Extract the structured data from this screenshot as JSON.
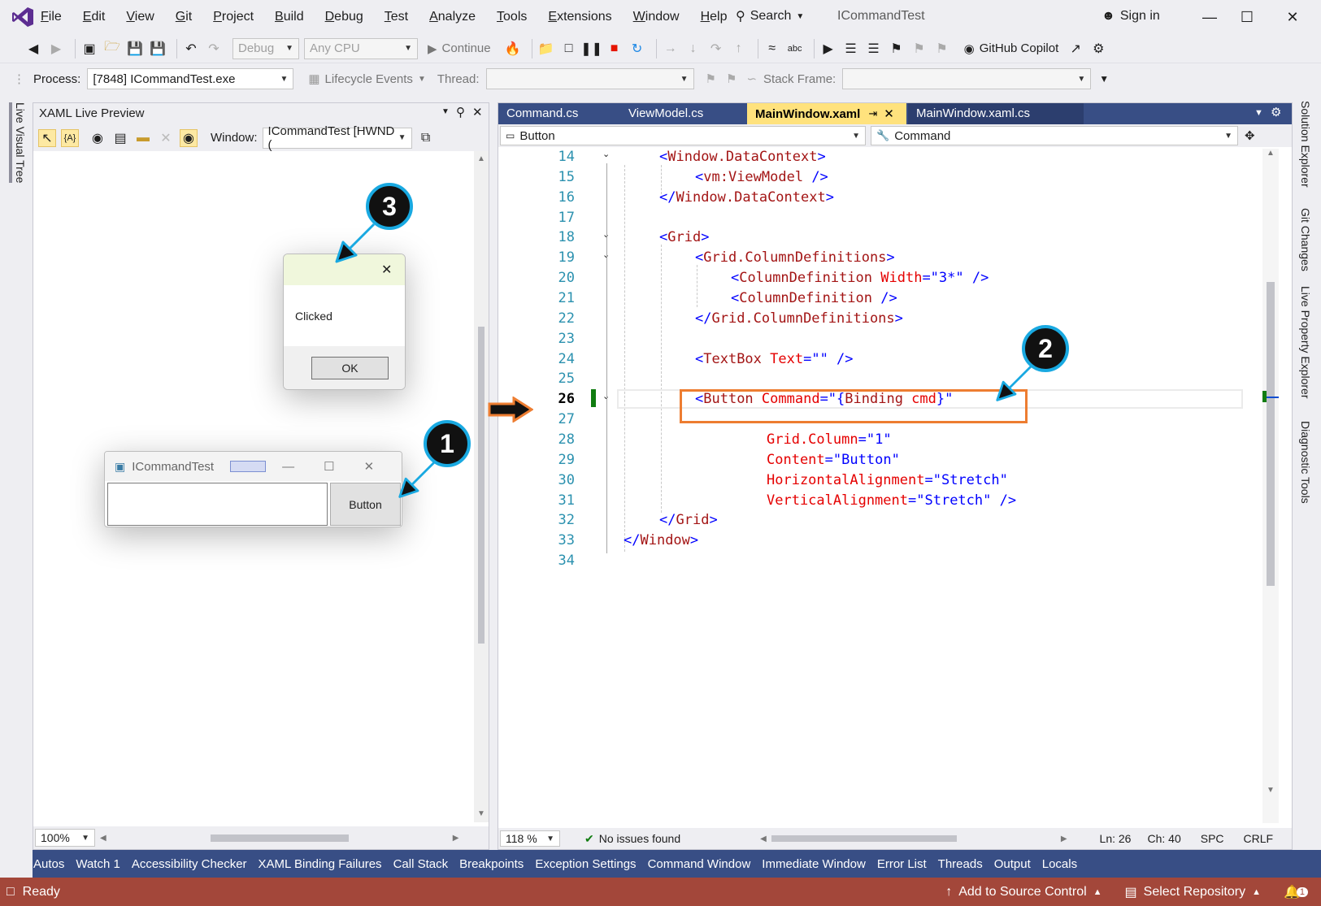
{
  "title_bar": {
    "menus": [
      "File",
      "Edit",
      "View",
      "Git",
      "Project",
      "Build",
      "Debug",
      "Test",
      "Analyze",
      "Tools",
      "Extensions",
      "Window",
      "Help"
    ],
    "search_label": "Search",
    "app_name": "ICommandTest",
    "sign_in": "Sign in"
  },
  "toolbar": {
    "config": "Debug",
    "platform": "Any CPU",
    "continue_label": "Continue",
    "copilot_label": "GitHub Copilot"
  },
  "debug_toolbar": {
    "process_label": "Process:",
    "process_value": "[7848] ICommandTest.exe",
    "lifecycle_label": "Lifecycle Events",
    "thread_label": "Thread:",
    "stack_frame_label": "Stack Frame:"
  },
  "left_strip": {
    "label": "Live Visual Tree"
  },
  "right_strip": {
    "labels": [
      "Solution Explorer",
      "Git Changes",
      "Live Property Explorer",
      "Diagnostic Tools"
    ]
  },
  "live_preview": {
    "title": "XAML Live Preview",
    "window_label": "Window:",
    "window_value": "ICommandTest [HWND (",
    "zoom": "100%"
  },
  "message_box": {
    "text": "Clicked",
    "ok_label": "OK"
  },
  "app_window": {
    "title": "ICommandTest",
    "button_label": "Button"
  },
  "editor": {
    "tabs": [
      "Command.cs",
      "ViewModel.cs",
      "MainWindow.xaml",
      "MainWindow.xaml.cs"
    ],
    "active_tab": "MainWindow.xaml",
    "nav_left": "Button",
    "nav_right": "Command",
    "line_numbers": [
      "14",
      "15",
      "16",
      "17",
      "18",
      "19",
      "20",
      "21",
      "22",
      "23",
      "24",
      "25",
      "26",
      "27",
      "28",
      "29",
      "30",
      "31",
      "32",
      "33",
      "34"
    ],
    "current_line": "26",
    "zoom": "118 %",
    "issues": "No issues found",
    "ln": "Ln: 26",
    "ch": "Ch: 40",
    "spc": "SPC",
    "crlf": "CRLF",
    "code": {
      "l14": [
        "<",
        "Window.DataContext",
        ">"
      ],
      "l15": [
        "<",
        "vm:ViewModel",
        " />"
      ],
      "l16": [
        "</",
        "Window.DataContext",
        ">"
      ],
      "l18": [
        "<",
        "Grid",
        ">"
      ],
      "l19": [
        "<",
        "Grid.ColumnDefinitions",
        ">"
      ],
      "l20": [
        "<",
        "ColumnDefinition",
        " Width",
        "=\"",
        "3*",
        "\" />"
      ],
      "l21": [
        "<",
        "ColumnDefinition",
        " />"
      ],
      "l22": [
        "</",
        "Grid.ColumnDefinitions",
        ">"
      ],
      "l24": [
        "<",
        "TextBox",
        " Text",
        "=\"\" />"
      ],
      "l26": [
        "<",
        "Button",
        " Command",
        "=\"{",
        "Binding",
        " cmd",
        "}\""
      ],
      "l28": [
        "Grid.Column",
        "=\"",
        "1",
        "\""
      ],
      "l29": [
        "Content",
        "=\"",
        "Button",
        "\""
      ],
      "l30": [
        "HorizontalAlignment",
        "=\"",
        "Stretch",
        "\""
      ],
      "l31": [
        "VerticalAlignment",
        "=\"",
        "Stretch",
        "\" />"
      ],
      "l32": [
        "</",
        "Grid",
        ">"
      ],
      "l33": [
        "</",
        "Window",
        ">"
      ]
    }
  },
  "bottom_tabs": [
    "Autos",
    "Watch 1",
    "Accessibility Checker",
    "XAML Binding Failures",
    "Call Stack",
    "Breakpoints",
    "Exception Settings",
    "Command Window",
    "Immediate Window",
    "Error List",
    "Threads",
    "Output",
    "Locals"
  ],
  "status": {
    "ready": "Ready",
    "source_control": "Add to Source Control",
    "repository": "Select Repository",
    "notifications": "1"
  },
  "callouts": [
    "1",
    "2",
    "3"
  ],
  "colors": {
    "accent": "#384e85",
    "status_bar": "#a3473a",
    "callout_ring": "#19a9e1",
    "highlight_box": "#ed7d31"
  }
}
